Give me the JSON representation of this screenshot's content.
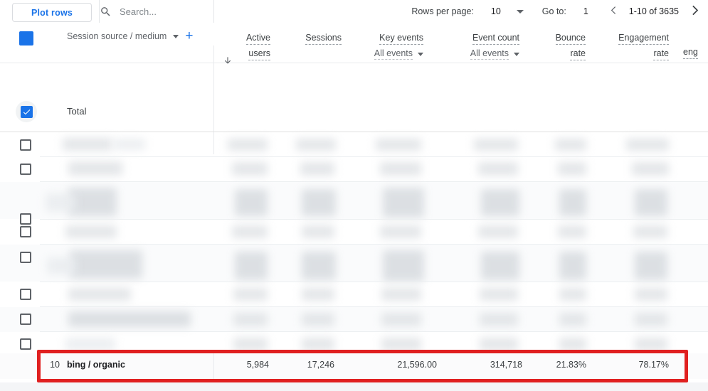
{
  "toolbar": {
    "plot_rows_label": "Plot rows",
    "search_placeholder": "Search...",
    "search_value": "",
    "search_icon": "search-icon",
    "rows_per_page_label": "Rows per page:",
    "rows_per_page_value": "10",
    "rows_per_page_caret": "chevron-down-icon",
    "goto_label": "Go to:",
    "goto_value": "1",
    "prev_icon": "chevron-left-icon",
    "next_icon": "chevron-right-icon",
    "range_label": "1-10 of 3635"
  },
  "header": {
    "select_all_icon": "checkbox-checked-icon",
    "dimension_label": "Session source / medium",
    "dimension_caret": "chevron-down-icon",
    "add_dimension_icon": "plus-icon",
    "sort_icon": "arrow-down-icon",
    "metrics": [
      {
        "line1": "Active",
        "line2": "users",
        "sub": "",
        "sub_caret": false
      },
      {
        "line1": "Sessions",
        "line2": "",
        "sub": "",
        "sub_caret": false
      },
      {
        "line1": "Key events",
        "line2": "",
        "sub": "All events",
        "sub_caret": true
      },
      {
        "line1": "Event count",
        "line2": "",
        "sub": "All events",
        "sub_caret": true
      },
      {
        "line1": "Bounce",
        "line2": "rate",
        "sub": "",
        "sub_caret": false
      },
      {
        "line1": "Engagement",
        "line2": "rate",
        "sub": "",
        "sub_caret": false
      },
      {
        "line1": "",
        "line2": "eng",
        "sub": "",
        "sub_caret": false
      }
    ]
  },
  "total_row": {
    "label": "Total",
    "checked": true,
    "values_redacted": true
  },
  "table": {
    "redacted_row_count": 9,
    "highlighted_row": {
      "index": "10",
      "source_medium": "bing / organic",
      "active_users": "5,984",
      "sessions": "17,246",
      "key_events": "21,596.00",
      "event_count": "314,718",
      "bounce_rate": "21.83%",
      "engagement_rate": "78.17%",
      "highlight_color": "#e02020",
      "checked": false
    }
  },
  "colors": {
    "accent": "#1a73e8",
    "text": "#3c4043",
    "muted": "#5f6368",
    "highlight": "#e02020",
    "border": "#e8eaed"
  }
}
